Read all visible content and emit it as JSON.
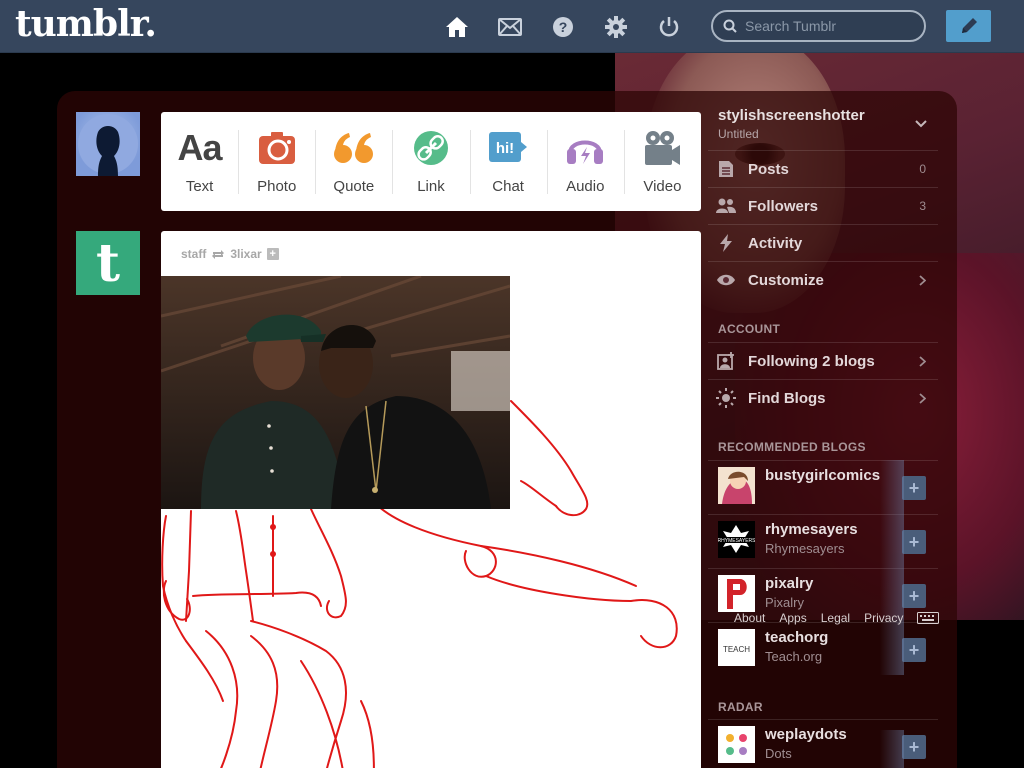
{
  "header": {
    "logo": "tumblr.",
    "search_placeholder": "Search Tumblr",
    "icons": [
      "home-icon",
      "mail-icon",
      "help-icon",
      "gear-icon",
      "power-icon",
      "pencil-icon"
    ]
  },
  "post_types": [
    {
      "label": "Text",
      "icon": "text-icon",
      "color": "#444444"
    },
    {
      "label": "Photo",
      "icon": "camera-icon",
      "color": "#d95e40"
    },
    {
      "label": "Quote",
      "icon": "quote-icon",
      "color": "#f2992e"
    },
    {
      "label": "Link",
      "icon": "link-icon",
      "color": "#56bc8a"
    },
    {
      "label": "Chat",
      "icon": "chat-icon",
      "color": "#529ecc"
    },
    {
      "label": "Audio",
      "icon": "headphones-icon",
      "color": "#a77dc2"
    },
    {
      "label": "Video",
      "icon": "video-camera-icon",
      "color": "#748089"
    }
  ],
  "post": {
    "author": "staff",
    "reblogged_from": "3lixar"
  },
  "sidebar": {
    "blog_name": "stylishscreenshotter",
    "blog_title": "Untitled",
    "items": [
      {
        "label": "Posts",
        "value": "0",
        "icon": "posts-icon"
      },
      {
        "label": "Followers",
        "value": "3",
        "icon": "followers-icon"
      },
      {
        "label": "Activity",
        "value": "",
        "icon": "lightning-icon"
      },
      {
        "label": "Customize",
        "value": "",
        "icon": "eye-icon"
      }
    ],
    "account_heading": "ACCOUNT",
    "account_items": [
      {
        "label": "Following 2 blogs",
        "icon": "following-icon"
      },
      {
        "label": "Find Blogs",
        "icon": "compass-icon"
      }
    ],
    "recommended_heading": "RECOMMENDED BLOGS",
    "recommended": [
      {
        "name": "bustygirlcomics",
        "subtitle": ""
      },
      {
        "name": "rhymesayers",
        "subtitle": "Rhymesayers"
      },
      {
        "name": "pixalry",
        "subtitle": "Pixalry"
      },
      {
        "name": "teachorg",
        "subtitle": "Teach.org"
      }
    ],
    "radar_heading": "RADAR",
    "radar": {
      "name": "weplaydots",
      "subtitle": "Dots"
    },
    "footer_links": [
      "About",
      "Apps",
      "Legal",
      "Privacy"
    ]
  }
}
